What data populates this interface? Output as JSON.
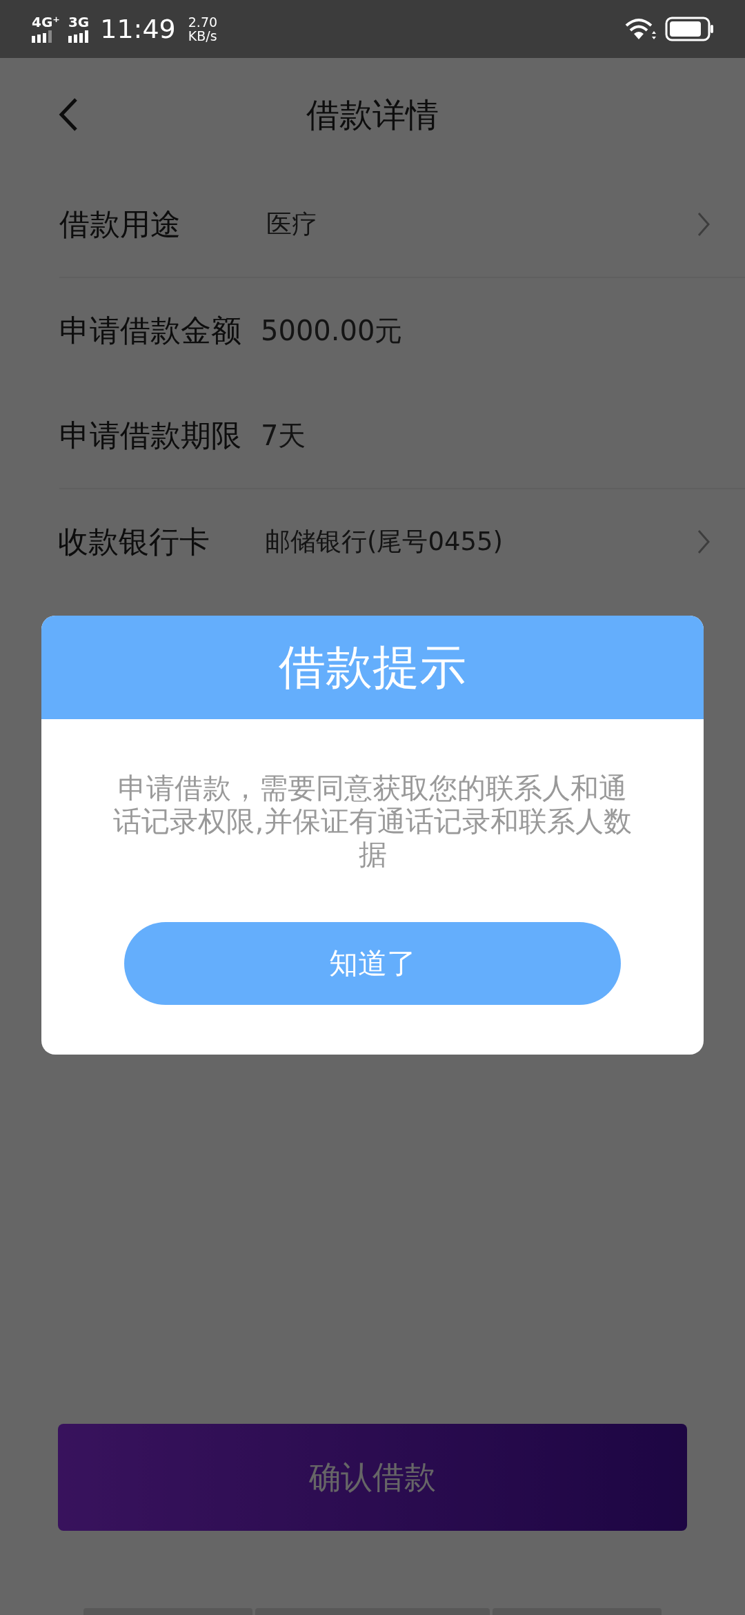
{
  "status_bar": {
    "network_1": "4G⁺",
    "network_2": "3G",
    "time": "11:49",
    "speed": "2.70",
    "speed_unit": "KB/s"
  },
  "header": {
    "title": "借款详情"
  },
  "rows": [
    {
      "label": "借款用途",
      "value": "医疗",
      "chevron": true,
      "divider": true
    },
    {
      "label": "申请借款金额",
      "value": "5000.00元",
      "chevron": false,
      "divider": false
    },
    {
      "label": "申请借款期限",
      "value": "7天",
      "chevron": false,
      "divider": true
    },
    {
      "label": "收款银行卡",
      "value": "邮储银行(尾号0455)",
      "chevron": true,
      "divider": false
    }
  ],
  "confirm_button": "确认借款",
  "dialog": {
    "title": "借款提示",
    "message": "申请借款，需要同意获取您的联系人和通话记录权限,并保证有通话记录和联系人数据",
    "button": "知道了"
  }
}
